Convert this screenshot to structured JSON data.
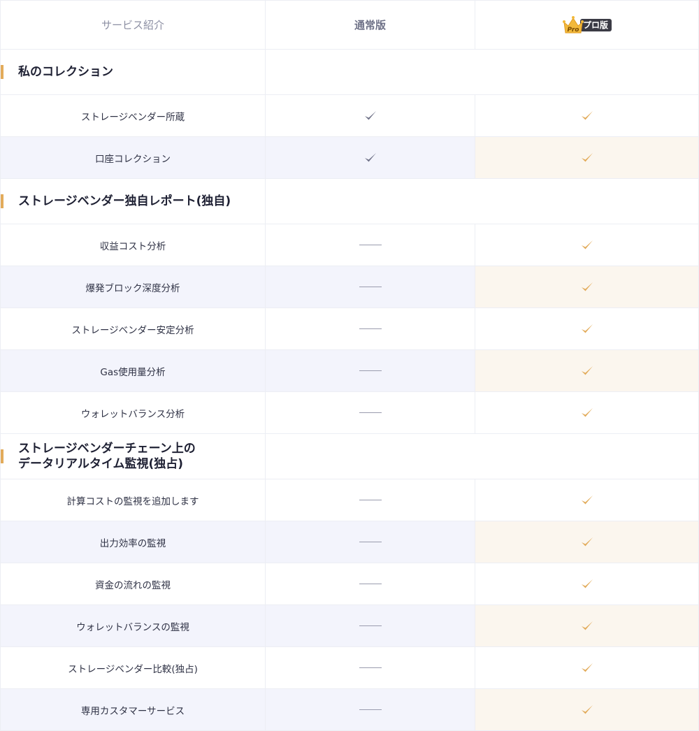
{
  "header": {
    "col1_label": "サービス紹介",
    "col2_label": "通常版",
    "col3_label": "プロ版",
    "crown_text": "Pro"
  },
  "colors": {
    "accent_gold": "#e2ab5a",
    "check_gray": "#6e7187",
    "alt_row_bg": "#f3f4fc",
    "pro_alt_bg": "#fbf6ee"
  },
  "sections": [
    {
      "title_lines": [
        "私のコレクション"
      ],
      "items": [
        {
          "label": "ストレージベンダー所蔵",
          "standard": "check",
          "pro": "check"
        },
        {
          "label": "口座コレクション",
          "standard": "check",
          "pro": "check"
        }
      ]
    },
    {
      "title_lines": [
        "ストレージベンダー独自レポート(独自)"
      ],
      "items": [
        {
          "label": "収益コスト分析",
          "standard": "dash",
          "pro": "check"
        },
        {
          "label": "爆発ブロック深度分析",
          "standard": "dash",
          "pro": "check"
        },
        {
          "label": "ストレージベンダー安定分析",
          "standard": "dash",
          "pro": "check"
        },
        {
          "label": "Gas使用量分析",
          "standard": "dash",
          "pro": "check"
        },
        {
          "label": "ウォレットバランス分析",
          "standard": "dash",
          "pro": "check"
        }
      ]
    },
    {
      "title_lines": [
        "ストレージベンダーチェーン上の",
        "データリアルタイム監視(独占)"
      ],
      "items": [
        {
          "label": "計算コストの監視を追加します",
          "standard": "dash",
          "pro": "check"
        },
        {
          "label": "出力効率の監視",
          "standard": "dash",
          "pro": "check"
        },
        {
          "label": "資金の流れの監視",
          "standard": "dash",
          "pro": "check"
        },
        {
          "label": "ウォレットバランスの監視",
          "standard": "dash",
          "pro": "check"
        },
        {
          "label": "ストレージベンダー比較(独占)",
          "standard": "dash",
          "pro": "check"
        },
        {
          "label": "専用カスタマーサービス",
          "standard": "dash",
          "pro": "check"
        }
      ]
    }
  ]
}
